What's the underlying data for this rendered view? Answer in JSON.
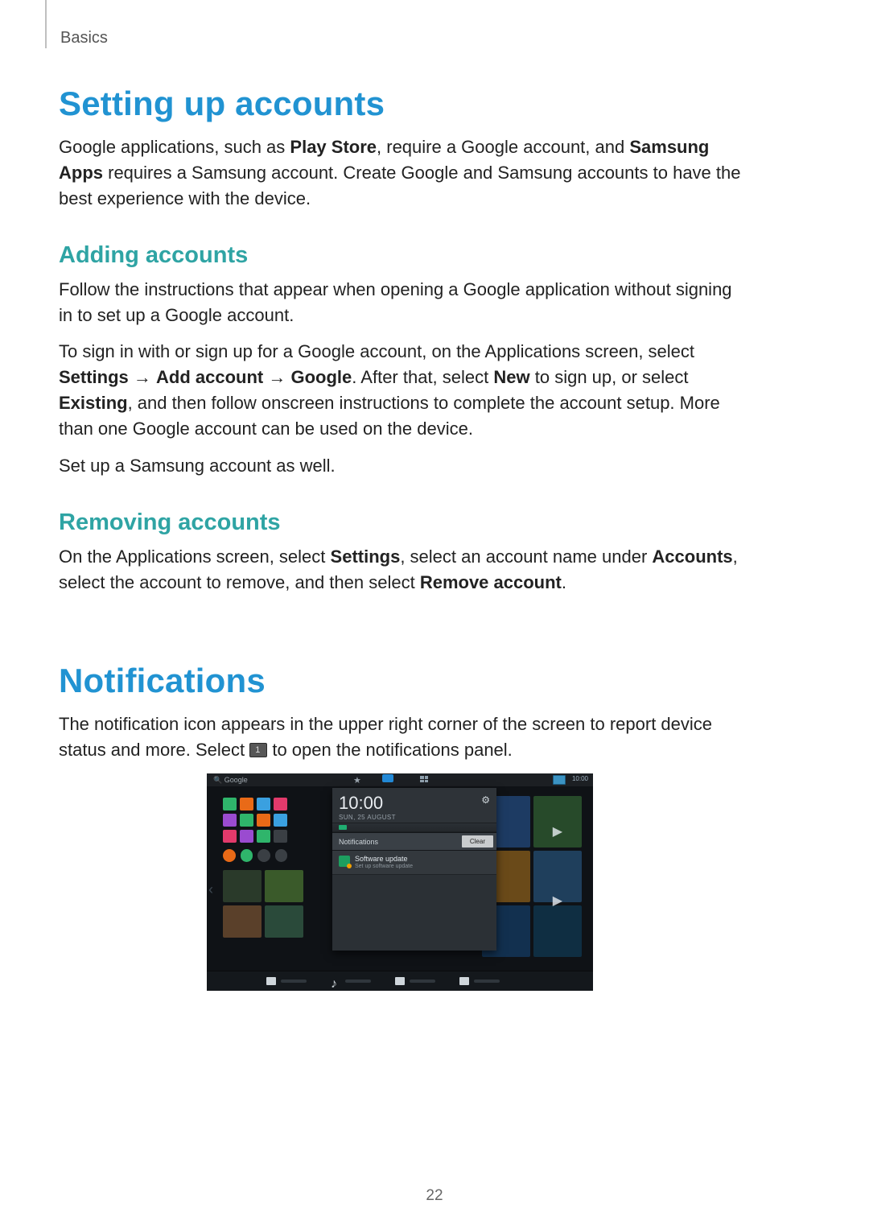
{
  "breadcrumb": "Basics",
  "page_number": "22",
  "s1": {
    "title": "Setting up accounts",
    "p1a": "Google applications, such as ",
    "p1b": "Play Store",
    "p1c": ", require a Google account, and ",
    "p1d": "Samsung Apps",
    "p1e": " requires a Samsung account. Create Google and Samsung accounts to have the best experience with the device."
  },
  "s2": {
    "title": "Adding accounts",
    "p1": "Follow the instructions that appear when opening a Google application without signing in to set up a Google account.",
    "p2a": "To sign in with or sign up for a Google account, on the Applications screen, select ",
    "p2b": "Settings",
    "p2c": " → ",
    "p2d": "Add account",
    "p2e": " → ",
    "p2f": "Google",
    "p2g": ". After that, select ",
    "p2h": "New",
    "p2i": " to sign up, or select ",
    "p2j": "Existing",
    "p2k": ", and then follow onscreen instructions to complete the account setup. More than one Google account can be used on the device.",
    "p3": "Set up a Samsung account as well."
  },
  "s3": {
    "title": "Removing accounts",
    "p1a": "On the Applications screen, select ",
    "p1b": "Settings",
    "p1c": ", select an account name under ",
    "p1d": "Accounts",
    "p1e": ", select the account to remove, and then select ",
    "p1f": "Remove account",
    "p1g": "."
  },
  "s4": {
    "title": "Notifications",
    "p1a": "The notification icon appears in the upper right corner of the screen to report device status and more. Select ",
    "p1b": " to open the notifications panel."
  },
  "shot": {
    "search_hint": "Google",
    "status_time": "10:00",
    "panel": {
      "clock_time": "10:00",
      "clock_date": "SUN, 25 AUGUST",
      "header": "Notifications",
      "clear": "Clear",
      "item_title": "Software update",
      "item_sub": "Set up software update"
    },
    "widget_colors": [
      "#2fb56b",
      "#e96a17",
      "#3aa0e0",
      "#e23a6b",
      "#9a4bd0",
      "#2fb56b",
      "#e96a17",
      "#3aa0e0",
      "#e23a6b",
      "#9a4bd0",
      "#2fb56b",
      "#3a3f44"
    ],
    "row2_colors": [
      "#e96a17",
      "#2fb56b",
      "#3a3f44",
      "#3a3f44"
    ],
    "tiles": [
      "#1d3b63",
      "#274a2a",
      "#6a4a19",
      "#1f3f5c",
      "#12304f",
      "#0f2e42"
    ]
  }
}
